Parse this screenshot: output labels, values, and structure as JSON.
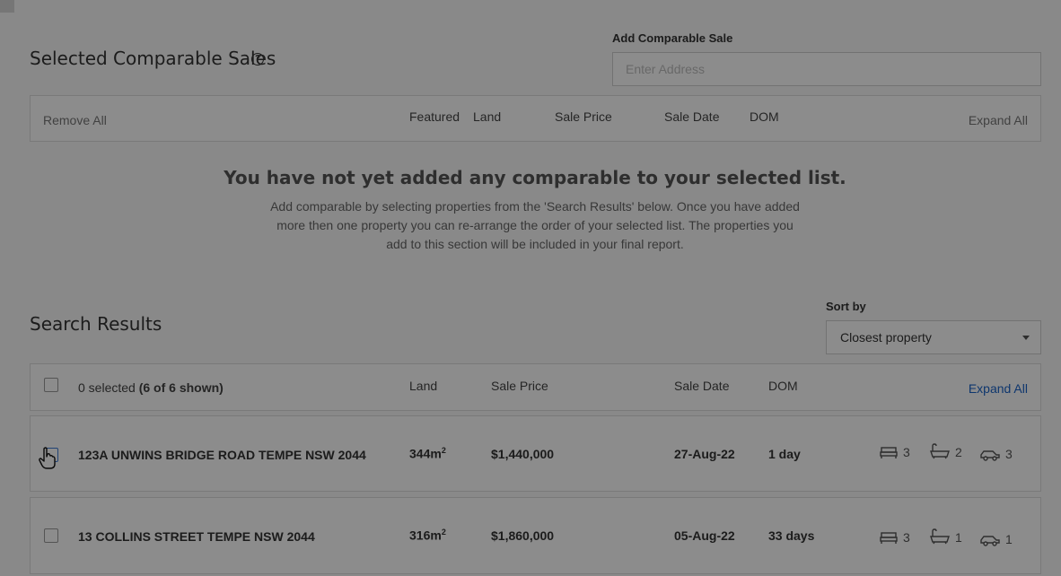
{
  "selected": {
    "title": "Selected Comparable Sales",
    "help_icon": "question-circle-icon",
    "add_label": "Add Comparable Sale",
    "add_placeholder": "Enter Address",
    "header": {
      "remove_all": "Remove All",
      "featured": "Featured",
      "land": "Land",
      "sale_price": "Sale Price",
      "sale_date": "Sale Date",
      "dom": "DOM",
      "expand_all": "Expand All"
    },
    "empty": {
      "title": "You have not yet added any comparable to your selected list.",
      "body": "Add comparable by selecting properties from the 'Search Results' below. Once you have added more then one property you can re-arrange the order of your selected list. The properties you add to this section will be included in your final report."
    }
  },
  "search": {
    "title": "Search Results",
    "sort_label": "Sort by",
    "sort_value": "Closest property",
    "header": {
      "selected_count": "0 selected",
      "shown": "(6 of 6 shown)",
      "land": "Land",
      "sale_price": "Sale Price",
      "sale_date": "Sale Date",
      "dom": "DOM",
      "expand_all": "Expand All"
    },
    "rows": [
      {
        "address": "123A UNWINS BRIDGE ROAD TEMPE NSW 2044",
        "land": "344m",
        "land_sup": "2",
        "price": "$1,440,000",
        "date": "27-Aug-22",
        "dom": "1 day",
        "beds": "3",
        "baths": "2",
        "cars": "3"
      },
      {
        "address": "13 COLLINS STREET TEMPE NSW 2044",
        "land": "316m",
        "land_sup": "2",
        "price": "$1,860,000",
        "date": "05-Aug-22",
        "dom": "33 days",
        "beds": "3",
        "baths": "1",
        "cars": "1"
      }
    ]
  },
  "icons": {
    "bed": "bed-icon",
    "bath": "bath-icon",
    "car": "car-icon",
    "cursor": "hand-pointer-icon"
  },
  "colors": {
    "link": "#1a63c8",
    "overlay": "rgba(0,0,0,0.45)"
  }
}
